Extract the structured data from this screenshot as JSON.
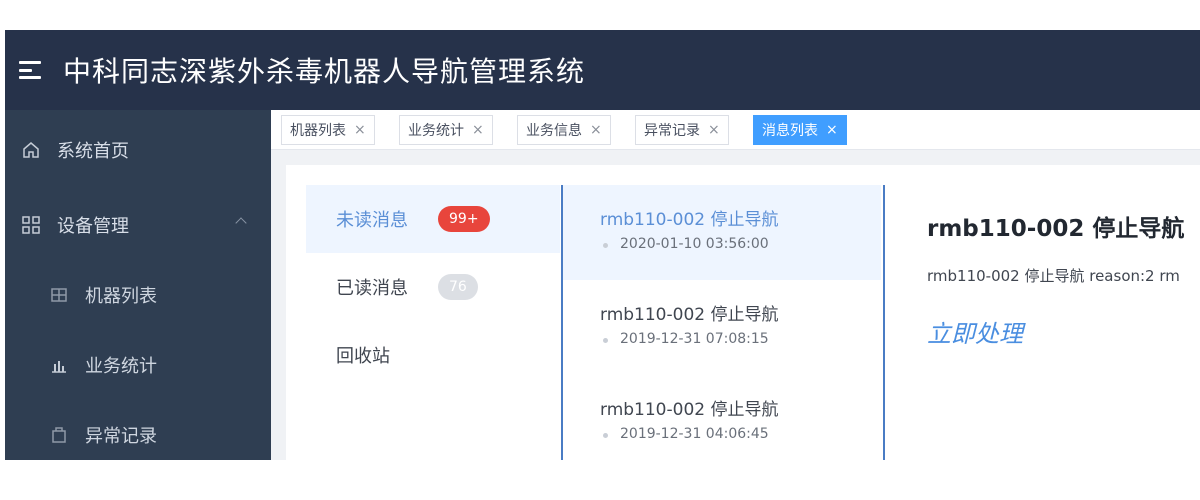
{
  "header": {
    "title": "中科同志深紫外杀毒机器人导航管理系统"
  },
  "sidebar": {
    "items": [
      {
        "label": "系统首页",
        "icon": "home-icon"
      },
      {
        "label": "设备管理",
        "icon": "grid-icon"
      },
      {
        "label": "机器列表",
        "icon": "robot-icon"
      },
      {
        "label": "业务统计",
        "icon": "bar-chart-icon"
      },
      {
        "label": "异常记录",
        "icon": "alert-record-icon"
      }
    ]
  },
  "tabs": [
    {
      "label": "机器列表"
    },
    {
      "label": "业务统计"
    },
    {
      "label": "业务信息"
    },
    {
      "label": "异常记录"
    },
    {
      "label": "消息列表"
    }
  ],
  "close_glyph": "×",
  "categories": [
    {
      "label": "未读消息",
      "badge": "99+"
    },
    {
      "label": "已读消息",
      "badge": "76"
    },
    {
      "label": "回收站"
    }
  ],
  "messages": [
    {
      "title": "rmb110-002 停止导航",
      "time": "2020-01-10 03:56:00"
    },
    {
      "title": "rmb110-002 停止导航",
      "time": "2019-12-31 07:08:15"
    },
    {
      "title": "rmb110-002 停止导航",
      "time": "2019-12-31 04:06:45"
    }
  ],
  "detail": {
    "title": "rmb110-002 停止导航",
    "body": "rmb110-002 停止导航 reason:2 rm",
    "action": "立即处理"
  },
  "colors": {
    "header_bg": "#26324a",
    "sidebar_bg": "#2f3e52",
    "accent": "#409eff",
    "badge_red": "#e8453c"
  }
}
